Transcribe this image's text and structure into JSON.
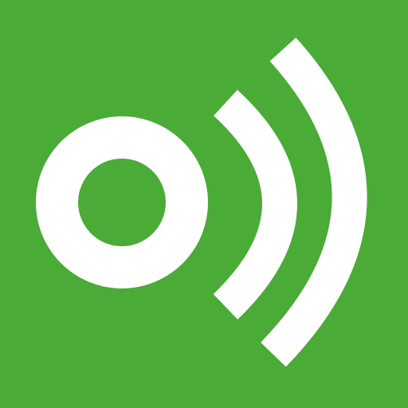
{
  "icon": {
    "name": "broadcast-signal-icon",
    "background_color": "#4aab37",
    "foreground_color": "#ffffff",
    "signal_waves": 2
  }
}
